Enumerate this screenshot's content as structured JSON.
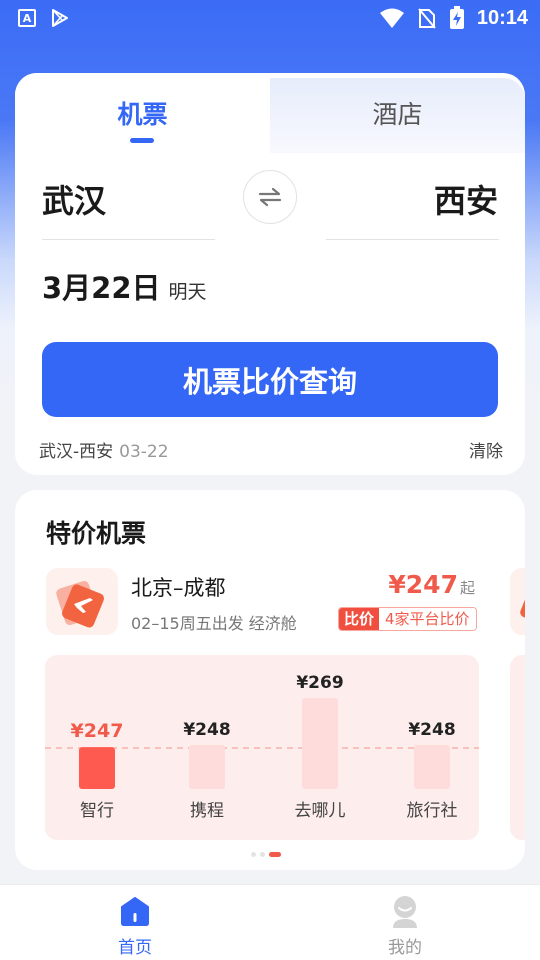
{
  "status_bar": {
    "time": "10:14",
    "left_icons": [
      "app-a-icon",
      "play-store-icon"
    ],
    "right_icons": [
      "wifi-icon",
      "no-sim-icon",
      "battery-charging-icon"
    ]
  },
  "tabs": {
    "flight": "机票",
    "hotel": "酒店",
    "active": "flight"
  },
  "search": {
    "from_city": "武汉",
    "to_city": "西安",
    "date": "3月22日",
    "date_note": "明天",
    "button_label": "机票比价查询",
    "history_route": "武汉-西安",
    "history_date": "03-22",
    "clear_label": "清除"
  },
  "deals": {
    "title": "特价机票",
    "items": [
      {
        "route": "北京–成都",
        "info": "02–15周五出发 经济舱",
        "price": "¥247",
        "price_suffix": "起",
        "compare_label": "比价",
        "compare_text": "4家平台比价"
      }
    ],
    "pager": {
      "count": 3,
      "active_index": 2
    }
  },
  "chart_data": {
    "type": "bar",
    "categories": [
      "智行",
      "携程",
      "去哪儿",
      "旅行社"
    ],
    "values": [
      247,
      248,
      269,
      248
    ],
    "value_labels": [
      "¥247",
      "¥248",
      "¥269",
      "¥248"
    ],
    "highlight_index": 0,
    "colors": {
      "highlight": "#ff5a4f",
      "bar": "#ffdcdc",
      "highlight_label": "#f05a4b",
      "label": "#222222",
      "baseline": "#f5b3ab"
    }
  },
  "bottom_nav": {
    "home": "首页",
    "mine": "我的",
    "active": "home"
  },
  "colors": {
    "primary": "#3567f6",
    "accent_red": "#f05a4b"
  }
}
